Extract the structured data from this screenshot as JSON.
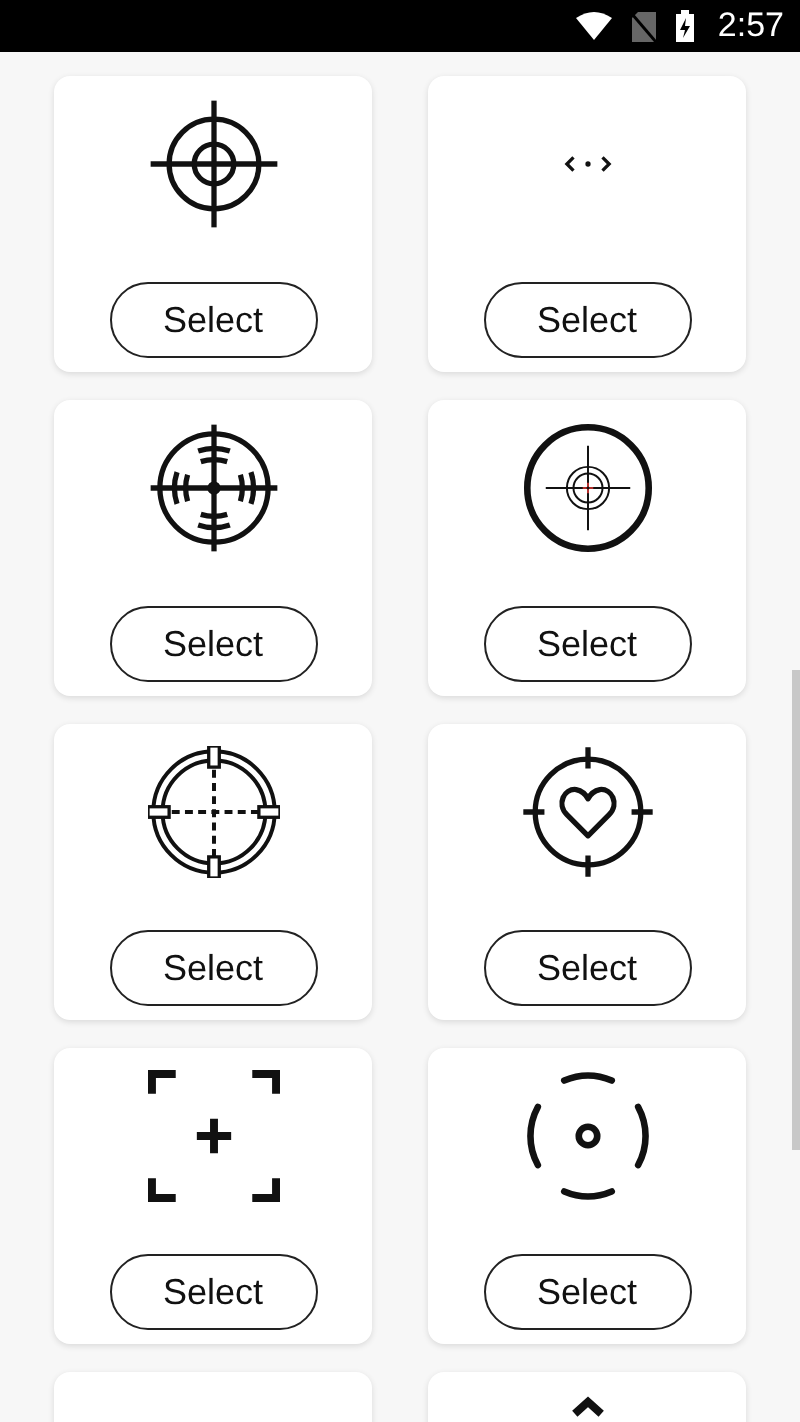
{
  "status_bar": {
    "time": "2:57"
  },
  "crosshairs": [
    {
      "kind": "scope",
      "button": "Select"
    },
    {
      "kind": "chevrons-dot",
      "button": "Select"
    },
    {
      "kind": "ranged",
      "button": "Select"
    },
    {
      "kind": "red-dot",
      "button": "Select"
    },
    {
      "kind": "dashed",
      "button": "Select"
    },
    {
      "kind": "heart",
      "button": "Select"
    },
    {
      "kind": "corner-plus",
      "button": "Select"
    },
    {
      "kind": "dashed-ring",
      "button": "Select"
    },
    {
      "kind": "blank"
    },
    {
      "kind": "chevron"
    }
  ]
}
